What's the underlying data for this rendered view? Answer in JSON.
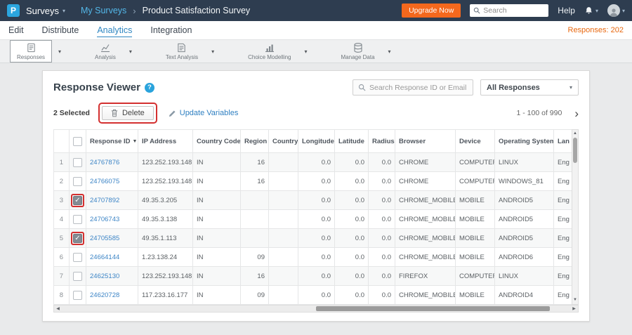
{
  "topbar": {
    "logo_letter": "P",
    "app_menu": "Surveys",
    "breadcrumb": "My Surveys",
    "survey_title": "Product Satisfaction Survey",
    "upgrade_label": "Upgrade Now",
    "search_placeholder": "Search",
    "help_label": "Help"
  },
  "nav": {
    "tabs": [
      {
        "label": "Edit",
        "active": false
      },
      {
        "label": "Distribute",
        "active": false
      },
      {
        "label": "Analytics",
        "active": true
      },
      {
        "label": "Integration",
        "active": false
      }
    ],
    "responses_count_label": "Responses: 202"
  },
  "toolbar": {
    "items": [
      {
        "label": "Responses",
        "icon": "responses-icon",
        "selected": true
      },
      {
        "label": "Analysis",
        "icon": "analysis-icon",
        "selected": false
      },
      {
        "label": "Text Analysis",
        "icon": "text-analysis-icon",
        "selected": false
      },
      {
        "label": "Choice Modelling",
        "icon": "choice-modelling-icon",
        "selected": false
      },
      {
        "label": "Manage Data",
        "icon": "manage-data-icon",
        "selected": false
      }
    ]
  },
  "viewer": {
    "title": "Response Viewer",
    "help_icon": "?",
    "search_placeholder": "Search Response ID or Email",
    "filter_value": "All Responses",
    "selected_text": "2 Selected",
    "delete_label": "Delete",
    "update_variables_label": "Update Variables",
    "pagination": "1 - 100 of 990"
  },
  "table": {
    "sorted_column": "Response ID",
    "columns": [
      "",
      "",
      "Response ID",
      "IP Address",
      "Country Code",
      "Region",
      "Country",
      "Longitude",
      "Latitude",
      "Radius",
      "Browser",
      "Device",
      "Operating System",
      "Lan"
    ],
    "rows": [
      {
        "num": "1",
        "checked": false,
        "annotated": false,
        "response_id": "24767876",
        "ip": "123.252.193.148",
        "country_code": "IN",
        "region": "16",
        "country": "",
        "longitude": "0.0",
        "latitude": "0.0",
        "radius": "0.0",
        "browser": "CHROME",
        "device": "COMPUTER",
        "os": "LINUX",
        "language": "Eng"
      },
      {
        "num": "2",
        "checked": false,
        "annotated": false,
        "response_id": "24766075",
        "ip": "123.252.193.148",
        "country_code": "IN",
        "region": "16",
        "country": "",
        "longitude": "0.0",
        "latitude": "0.0",
        "radius": "0.0",
        "browser": "CHROME",
        "device": "COMPUTER",
        "os": "WINDOWS_81",
        "language": "Eng"
      },
      {
        "num": "3",
        "checked": true,
        "annotated": true,
        "response_id": "24707892",
        "ip": "49.35.3.205",
        "country_code": "IN",
        "region": "",
        "country": "",
        "longitude": "0.0",
        "latitude": "0.0",
        "radius": "0.0",
        "browser": "CHROME_MOBILE",
        "device": "MOBILE",
        "os": "ANDROID5",
        "language": "Eng"
      },
      {
        "num": "4",
        "checked": false,
        "annotated": false,
        "response_id": "24706743",
        "ip": "49.35.3.138",
        "country_code": "IN",
        "region": "",
        "country": "",
        "longitude": "0.0",
        "latitude": "0.0",
        "radius": "0.0",
        "browser": "CHROME_MOBILE",
        "device": "MOBILE",
        "os": "ANDROID5",
        "language": "Eng"
      },
      {
        "num": "5",
        "checked": true,
        "annotated": true,
        "response_id": "24705585",
        "ip": "49.35.1.113",
        "country_code": "IN",
        "region": "",
        "country": "",
        "longitude": "0.0",
        "latitude": "0.0",
        "radius": "0.0",
        "browser": "CHROME_MOBILE",
        "device": "MOBILE",
        "os": "ANDROID5",
        "language": "Eng"
      },
      {
        "num": "6",
        "checked": false,
        "annotated": false,
        "response_id": "24664144",
        "ip": "1.23.138.24",
        "country_code": "IN",
        "region": "09",
        "country": "",
        "longitude": "0.0",
        "latitude": "0.0",
        "radius": "0.0",
        "browser": "CHROME_MOBILE",
        "device": "MOBILE",
        "os": "ANDROID6",
        "language": "Eng"
      },
      {
        "num": "7",
        "checked": false,
        "annotated": false,
        "response_id": "24625130",
        "ip": "123.252.193.148",
        "country_code": "IN",
        "region": "16",
        "country": "",
        "longitude": "0.0",
        "latitude": "0.0",
        "radius": "0.0",
        "browser": "FIREFOX",
        "device": "COMPUTER",
        "os": "LINUX",
        "language": "Eng"
      },
      {
        "num": "8",
        "checked": false,
        "annotated": false,
        "response_id": "24620728",
        "ip": "117.233.16.177",
        "country_code": "IN",
        "region": "09",
        "country": "",
        "longitude": "0.0",
        "latitude": "0.0",
        "radius": "0.0",
        "browser": "CHROME_MOBILE",
        "device": "MOBILE",
        "os": "ANDROID4",
        "language": "Eng"
      }
    ]
  }
}
